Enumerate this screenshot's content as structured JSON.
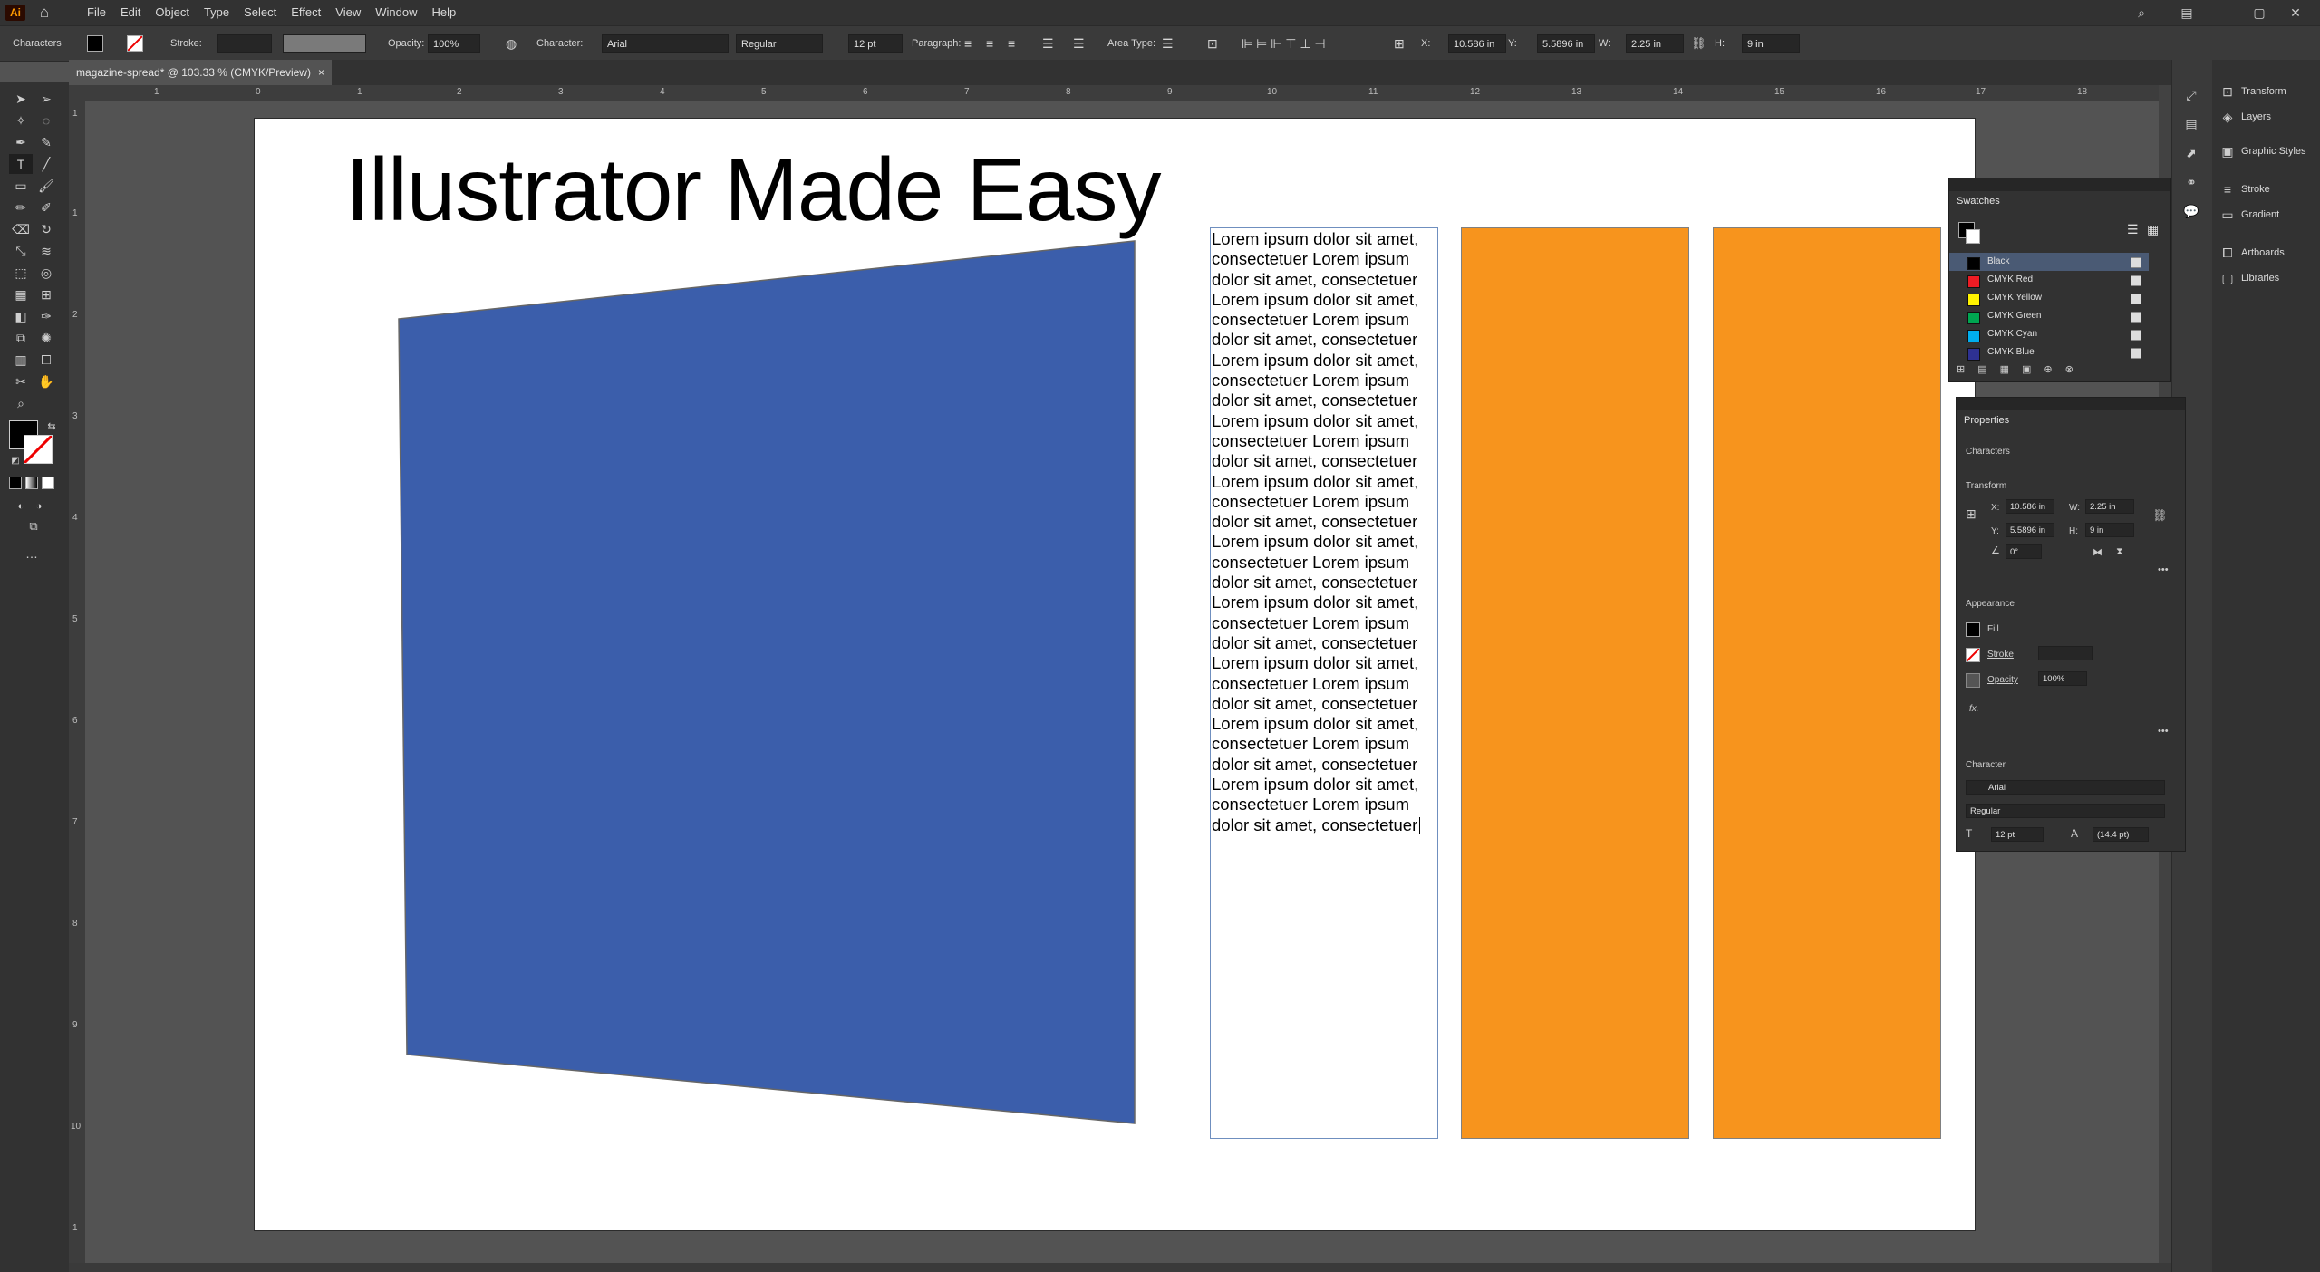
{
  "app": {
    "logo": "Ai",
    "menus": [
      "File",
      "Edit",
      "Object",
      "Type",
      "Select",
      "Effect",
      "View",
      "Window",
      "Help"
    ]
  },
  "control_bar": {
    "selection_label": "Characters",
    "stroke_label": "Stroke:",
    "opacity_label": "Opacity:",
    "opacity_value": "100%",
    "character_label": "Character:",
    "font_family": "Arial",
    "font_style": "Regular",
    "font_size": "12 pt",
    "paragraph_label": "Paragraph:",
    "area_type_label": "Area Type:",
    "x_label": "X:",
    "x_value": "10.586 in",
    "y_label": "Y:",
    "y_value": "5.5896 in",
    "w_label": "W:",
    "w_value": "2.25 in",
    "h_label": "H:",
    "h_value": "9 in"
  },
  "document": {
    "tab_title": "magazine-spread* @ 103.33 % (CMYK/Preview)",
    "close": "×"
  },
  "artboard": {
    "headline": "Illustrator Made Easy",
    "body_text": "Lorem ipsum dolor sit amet, consectetuer Lorem ipsum dolor sit amet, consectetuer Lorem ipsum dolor sit amet, consectetuer Lorem ipsum dolor sit amet, consectetuer Lorem ipsum dolor sit amet, consectetuer Lorem ipsum dolor sit amet, consectetuer Lorem ipsum dolor sit amet, consectetuer Lorem ipsum dolor sit amet, consectetuer Lorem ipsum dolor sit amet, consectetuer Lorem ipsum dolor sit amet, consectetuer Lorem ipsum dolor sit amet, consectetuer Lorem ipsum dolor sit amet, consectetuer Lorem ipsum dolor sit amet, consectetuer Lorem ipsum dolor sit amet, consectetuer Lorem ipsum dolor sit amet, consectetuer Lorem ipsum dolor sit amet, consectetuer Lorem ipsum dolor sit amet, consectetuer Lorem ipsum dolor sit amet, consectetuer Lorem ipsum dolor sit amet, consectetuer Lorem ipsum dolor sit amet, consectetuer",
    "blue_color": "#3b5eab",
    "orange_color": "#f7941d"
  },
  "rulers": {
    "top": [
      "1",
      "0",
      "1",
      "2",
      "3",
      "4",
      "5",
      "6",
      "7",
      "8",
      "9",
      "10",
      "11",
      "12",
      "13",
      "14",
      "15",
      "16",
      "17",
      "18"
    ],
    "left": [
      "1",
      "1",
      "2",
      "3",
      "4",
      "5",
      "6",
      "7",
      "8",
      "9",
      "10",
      "1"
    ]
  },
  "swatches": {
    "title": "Swatches",
    "items": [
      {
        "name": "Black",
        "color": "#000000"
      },
      {
        "name": "CMYK Red",
        "color": "#ed1c24"
      },
      {
        "name": "CMYK Yellow",
        "color": "#fff200"
      },
      {
        "name": "CMYK Green",
        "color": "#00a651"
      },
      {
        "name": "CMYK Cyan",
        "color": "#00aeef"
      },
      {
        "name": "CMYK Blue",
        "color": "#2e3192"
      }
    ]
  },
  "properties": {
    "title": "Properties",
    "subtitle": "Characters",
    "transform_label": "Transform",
    "x_label": "X:",
    "x_value": "10.586 in",
    "y_label": "Y:",
    "y_value": "5.5896 in",
    "w_label": "W:",
    "w_value": "2.25 in",
    "h_label": "H:",
    "h_value": "9 in",
    "angle_value": "0°",
    "appearance_label": "Appearance",
    "fill_label": "Fill",
    "stroke_label": "Stroke",
    "opacity_label": "Opacity",
    "opacity_value": "100%",
    "fx_label": "fx.",
    "character_label": "Character",
    "font_family": "Arial",
    "font_style": "Regular",
    "font_size": "12 pt",
    "leading": "(14.4 pt)"
  },
  "dock": {
    "items": [
      "Transform",
      "Layers",
      "Graphic Styles",
      "Stroke",
      "Gradient",
      "Artboards",
      "Libraries"
    ]
  }
}
